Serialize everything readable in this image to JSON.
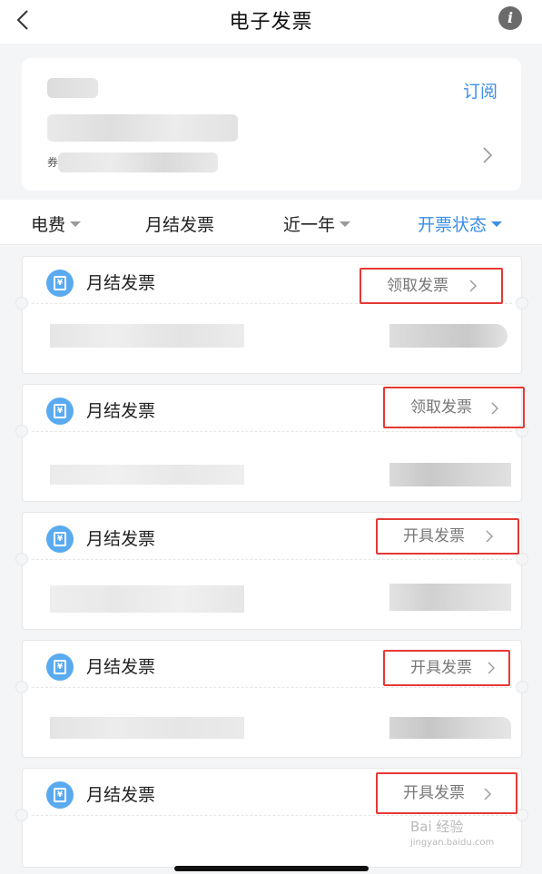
{
  "nav": {
    "title": "电子发票",
    "info_icon": "i"
  },
  "account": {
    "subscribe_label": "订阅",
    "partial_label": "券"
  },
  "filters": [
    {
      "label": "电费",
      "has_caret": true,
      "active": false
    },
    {
      "label": "月结发票",
      "has_caret": false,
      "active": false
    },
    {
      "label": "近一年",
      "has_caret": true,
      "active": false
    },
    {
      "label": "开票状态",
      "has_caret": true,
      "active": true
    }
  ],
  "invoices": [
    {
      "title": "月结发票",
      "action": "领取发票"
    },
    {
      "title": "月结发票",
      "action": "领取发票"
    },
    {
      "title": "月结发票",
      "action": "开具发票"
    },
    {
      "title": "月结发票",
      "action": "开具发票"
    },
    {
      "title": "月结发票",
      "action": "开具发票"
    }
  ],
  "icons": {
    "back": "chevron-left-icon",
    "info": "info-icon",
    "invoice": "invoice-yuan-icon",
    "chevron": "chevron-right-icon"
  },
  "colors": {
    "accent": "#3b8fe6",
    "highlight_border": "#e53935",
    "icon_bg": "#5aaaf0"
  },
  "watermark": {
    "brand": "Bai 经验",
    "site": "jingyan.baidu.com"
  }
}
